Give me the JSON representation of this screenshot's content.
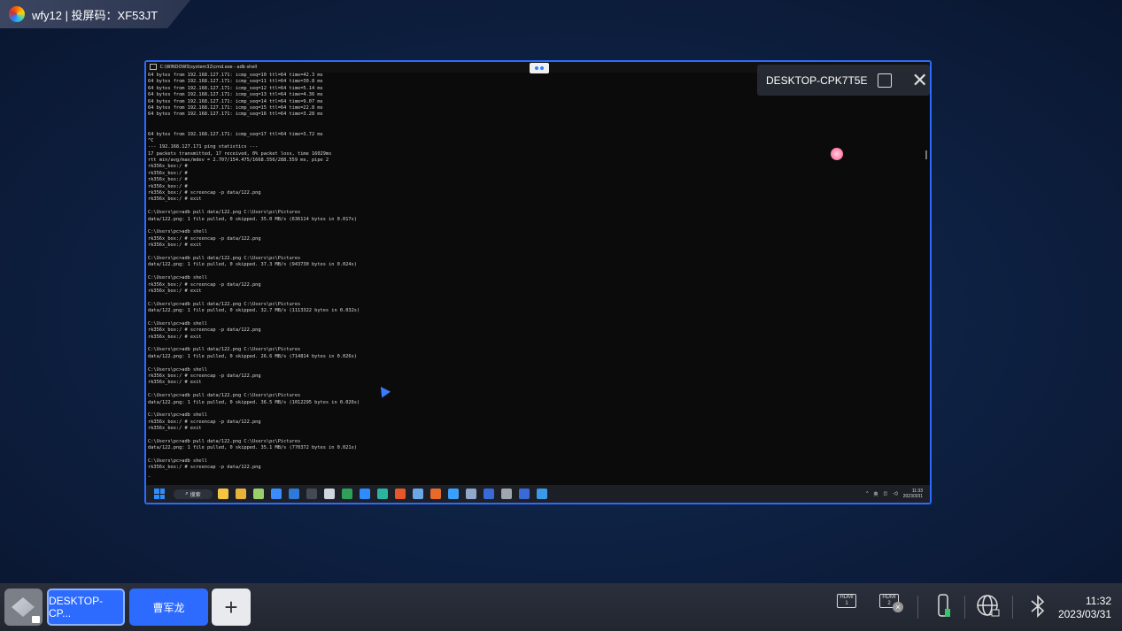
{
  "top_tab": {
    "label": "wfy12 | 投屏码：XF53JT"
  },
  "cmd_window": {
    "title": "C:\\WINDOWS\\system32\\cmd.exe - adb  shell"
  },
  "terminal_lines": [
    "64 bytes from 192.168.127.171: icmp_seq=10 ttl=64 time=42.3 ms",
    "64 bytes from 192.168.127.171: icmp_seq=11 ttl=64 time=30.8 ms",
    "64 bytes from 192.168.127.171: icmp_seq=12 ttl=64 time=5.14 ms",
    "64 bytes from 192.168.127.171: icmp_seq=13 ttl=64 time=4.36 ms",
    "64 bytes from 192.168.127.171: icmp_seq=14 ttl=64 time=9.07 ms",
    "64 bytes from 192.168.127.171: icmp_seq=15 ttl=64 time=22.8 ms",
    "64 bytes from 192.168.127.171: icmp_seq=16 ttl=64 time=3.28 ms",
    "",
    "",
    "64 bytes from 192.168.127.171: icmp_seq=17 ttl=64 time=3.72 ms",
    "^C",
    "--- 192.168.127.171 ping statistics ---",
    "17 packets transmitted, 17 received, 0% packet loss, time 16029ms",
    "rtt min/avg/max/mdev = 2.707/154.475/1668.556/288.559 ms, pipe 2",
    "rk356x_box:/ #",
    "rk356x_box:/ #",
    "rk356x_box:/ #",
    "rk356x_box:/ #",
    "rk356x_box:/ # screencap -p data/122.png",
    "rk356x_box:/ # exit",
    "",
    "C:\\Users\\pc>adb pull data/122.png C:\\Users\\pc\\Pictures",
    "data/122.png: 1 file pulled, 0 skipped. 35.0 MB/s (636114 bytes in 0.017s)",
    "",
    "C:\\Users\\pc>adb shell",
    "rk356x_box:/ # screencap -p data/122.png",
    "rk356x_box:/ # exit",
    "",
    "C:\\Users\\pc>adb pull data/122.png C:\\Users\\pc\\Pictures",
    "data/122.png: 1 file pulled, 0 skipped. 37.3 MB/s (943730 bytes in 0.024s)",
    "",
    "C:\\Users\\pc>adb shell",
    "rk356x_box:/ # screencap -p data/122.png",
    "rk356x_box:/ # exit",
    "",
    "C:\\Users\\pc>adb pull data/122.png C:\\Users\\pc\\Pictures",
    "data/122.png: 1 file pulled, 0 skipped. 32.7 MB/s (1113322 bytes in 0.032s)",
    "",
    "C:\\Users\\pc>adb shell",
    "rk356x_box:/ # screencap -p data/122.png",
    "rk356x_box:/ # exit",
    "",
    "C:\\Users\\pc>adb pull data/122.png C:\\Users\\pc\\Pictures",
    "data/122.png: 1 file pulled, 0 skipped. 26.6 MB/s (714814 bytes in 0.026s)",
    "",
    "C:\\Users\\pc>adb shell",
    "rk356x_box:/ # screencap -p data/122.png",
    "rk356x_box:/ # exit",
    "",
    "C:\\Users\\pc>adb pull data/122.png C:\\Users\\pc\\Pictures",
    "data/122.png: 1 file pulled, 0 skipped. 36.5 MB/s (1012295 bytes in 0.026s)",
    "",
    "C:\\Users\\pc>adb shell",
    "rk356x_box:/ # screencap -p data/122.png",
    "rk356x_box:/ # exit",
    "",
    "C:\\Users\\pc>adb pull data/122.png C:\\Users\\pc\\Pictures",
    "data/122.png: 1 file pulled, 0 skipped. 35.1 MB/s (770372 bytes in 0.021s)",
    "",
    "C:\\Users\\pc>adb shell",
    "rk356x_box:/ # screencap -p data/122.png",
    "_"
  ],
  "win_taskbar": {
    "search_label": "搜索",
    "app_icons": [
      {
        "name": "file-explorer-icon",
        "color": "#f5c542"
      },
      {
        "name": "chrome-icon",
        "color": "#e8b33a"
      },
      {
        "name": "notepad-icon",
        "color": "#9ad06a"
      },
      {
        "name": "docs-icon",
        "color": "#3a8cff"
      },
      {
        "name": "outlook-icon",
        "color": "#2f7ad8"
      },
      {
        "name": "terminal-icon",
        "color": "#444a55"
      },
      {
        "name": "photos-icon",
        "color": "#cfd6e0"
      },
      {
        "name": "excel-icon",
        "color": "#2fa05a"
      },
      {
        "name": "vscode-icon",
        "color": "#2f8cff"
      },
      {
        "name": "edge-icon",
        "color": "#2bb3a0"
      },
      {
        "name": "tool-icon",
        "color": "#e8572a"
      },
      {
        "name": "remote-icon",
        "color": "#6aa8e8"
      },
      {
        "name": "powerpoint-icon",
        "color": "#e86a2a"
      },
      {
        "name": "clock-icon",
        "color": "#3aa0ff"
      },
      {
        "name": "bird-icon",
        "color": "#8fa7c8"
      },
      {
        "name": "word-icon",
        "color": "#3a6ad8"
      },
      {
        "name": "settings-icon",
        "color": "#a0a6b0"
      },
      {
        "name": "mail-icon",
        "color": "#3a6ad8"
      },
      {
        "name": "snip-icon",
        "color": "#3a9ae8"
      }
    ],
    "tray_lang": "英",
    "tray_time": "11:33",
    "tray_date": "2023/3/31"
  },
  "cast_overlay": {
    "device_name": "DESKTOP-CPK7T5E"
  },
  "dock": {
    "source_tab_1": "DESKTOP-CP...",
    "source_tab_2": "曹军龙",
    "hdmi1_label": "HDMI 1",
    "hdmi2_label": "HDMI 2",
    "time": "11:32",
    "date": "2023/03/31"
  },
  "colors": {
    "accent": "#2d6bff"
  }
}
